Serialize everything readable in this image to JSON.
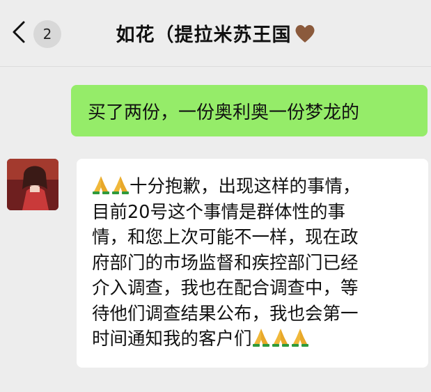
{
  "header": {
    "back_icon": "chevron-left-icon",
    "unread_count": "2",
    "title": "如花（提拉米苏王国",
    "title_emoji": "brown-heart-icon"
  },
  "colors": {
    "background": "#ededed",
    "outgoing_bubble": "#95ec69",
    "incoming_bubble": "#ffffff"
  },
  "messages": [
    {
      "direction": "outgoing",
      "text": "买了两份，一份奥利奥一份梦龙的"
    },
    {
      "direction": "incoming",
      "sender_avatar": "avatar",
      "lines": [
        "十分抱歉，出现这样的事情，",
        "目前20号这个事情是群体性的事",
        "情，和您上次可能不一样，现在政",
        "府部门的市场监督和疾控部门已经",
        "介入调查，我也在配合调查中，等",
        "待他们调查结果公布，我也会第一",
        "时间通知我的客户们"
      ],
      "leading_emoji": "folded-hands-icon",
      "trailing_emoji": "folded-hands-icon"
    }
  ]
}
